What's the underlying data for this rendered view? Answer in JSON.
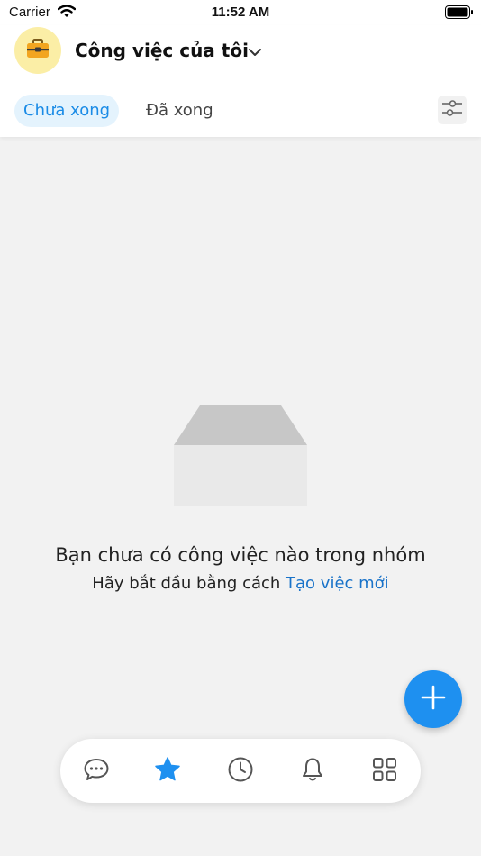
{
  "status_bar": {
    "carrier": "Carrier",
    "time": "11:52 AM"
  },
  "header": {
    "avatar_icon": "briefcase-icon",
    "title": "Công việc của tôi",
    "tabs": [
      {
        "label": "Chưa xong",
        "active": true
      },
      {
        "label": "Đã xong",
        "active": false
      }
    ],
    "filter_icon": "filter-sliders-icon"
  },
  "empty_state": {
    "title": "Bạn chưa có công việc nào trong nhóm",
    "subtitle_prefix": "Hãy bắt đầu bằng cách ",
    "subtitle_link": "Tạo việc mới"
  },
  "fab": {
    "icon": "plus-icon"
  },
  "bottom_nav": {
    "items": [
      {
        "icon": "chat-icon",
        "active": false
      },
      {
        "icon": "star-icon",
        "active": true
      },
      {
        "icon": "clock-icon",
        "active": false
      },
      {
        "icon": "bell-icon",
        "active": false
      },
      {
        "icon": "grid-icon",
        "active": false
      }
    ]
  },
  "colors": {
    "accent": "#1e90f0",
    "link": "#1a73c9",
    "active_tab_bg": "#e4f3fd",
    "avatar_bg": "#fbeea6",
    "background": "#f2f2f2"
  }
}
